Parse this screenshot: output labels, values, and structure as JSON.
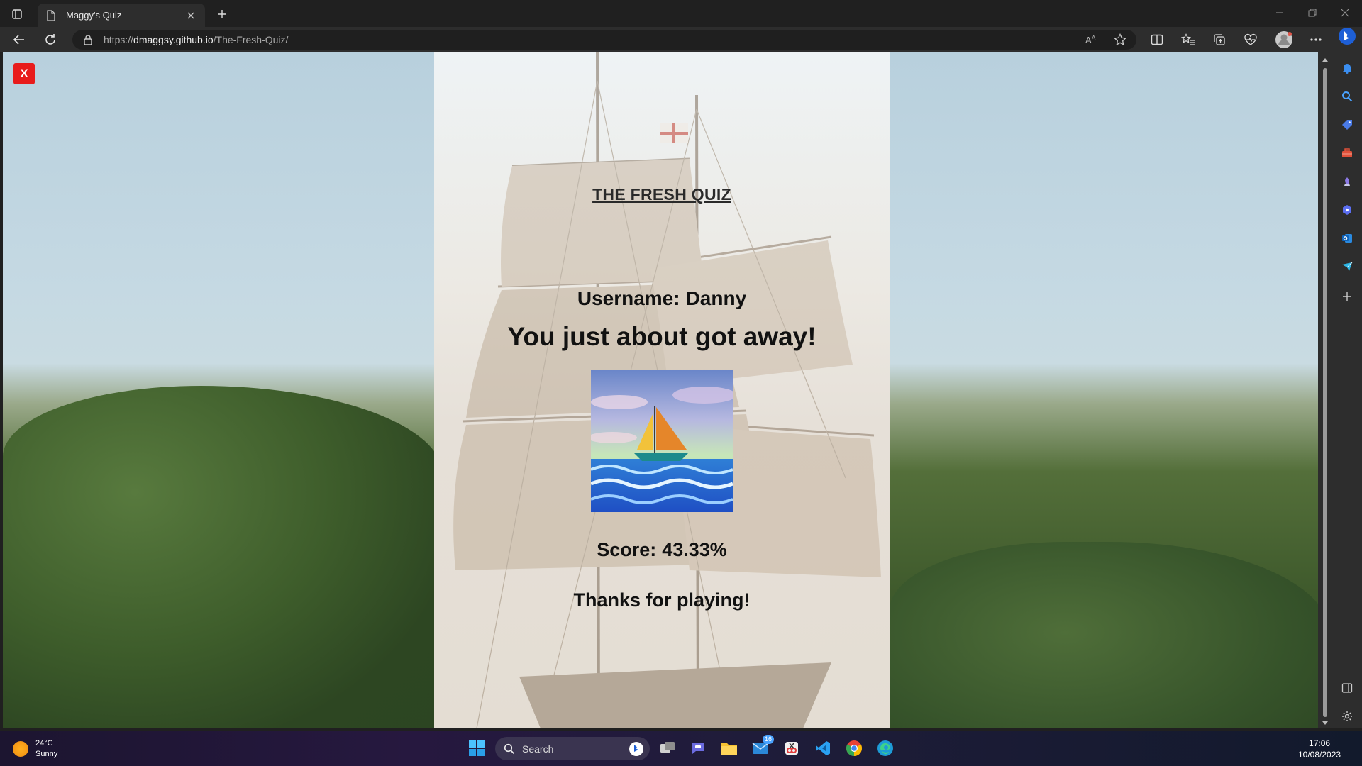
{
  "browser": {
    "tab_title": "Maggy's Quiz",
    "url_scheme": "https://",
    "url_domain": "dmaggsy.github.io",
    "url_path": "/The-Fresh-Quiz/"
  },
  "page": {
    "close_label": "X",
    "title": "THE FRESH QUIZ",
    "username_label": "Username:",
    "username_value": "Danny",
    "result_message": "You just about got away!",
    "score_label": "Score:",
    "score_value": "43.33%",
    "thanks": "Thanks for playing!"
  },
  "taskbar": {
    "temperature": "24°C",
    "weather": "Sunny",
    "search_label": "Search",
    "mail_badge": "16",
    "time": "17:06",
    "date": "10/08/2023"
  },
  "colors": {
    "close_button": "#e81b1b",
    "accent": "#4aa3ff"
  }
}
